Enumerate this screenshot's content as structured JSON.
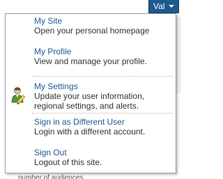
{
  "user_button": {
    "label": "Val"
  },
  "menu": {
    "items": [
      {
        "title": "My Site",
        "description": "Open your personal homepage"
      },
      {
        "title": "My Profile",
        "description": "View and manage your profile."
      },
      {
        "title": "My Settings",
        "description": "Update your user information, regional settings, and alerts.",
        "description_line1": "Update your user information,",
        "description_line2": "regional settings, and alerts."
      },
      {
        "title": "Sign in as Different User",
        "description": "Login with a different account."
      },
      {
        "title": "Sign Out",
        "description": "Logout of this site."
      }
    ]
  },
  "background": {
    "bottom_text": "number of audiences"
  },
  "colors": {
    "link": "#1b5aa4",
    "button": "#1c5a8f"
  }
}
